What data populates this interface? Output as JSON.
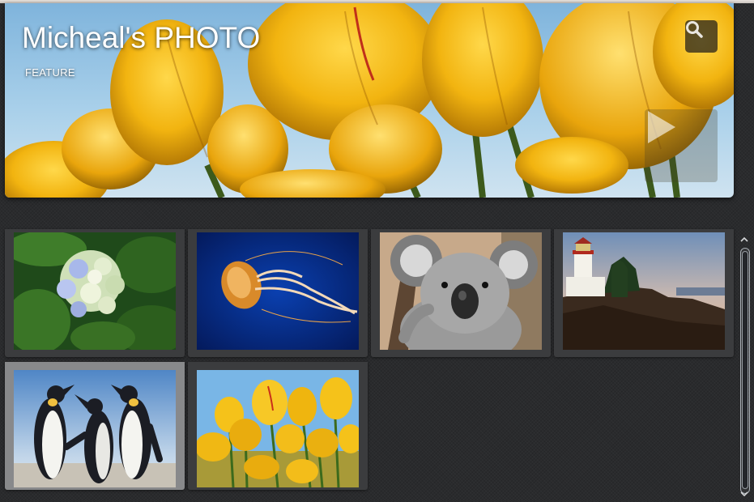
{
  "feature": {
    "title": "Micheal's PHOTO",
    "label": "FEATURE",
    "search_icon": "search-icon",
    "play_icon": "play-icon"
  },
  "gallery": {
    "photos": [
      {
        "subject": "hydrangea"
      },
      {
        "subject": "jellyfish"
      },
      {
        "subject": "koala"
      },
      {
        "subject": "lighthouse"
      },
      {
        "subject": "penguins",
        "selected": true
      },
      {
        "subject": "tulips"
      }
    ]
  },
  "scrollbar": {
    "up_icon": "chevron-up-icon",
    "down_icon": "chevron-down-icon"
  }
}
